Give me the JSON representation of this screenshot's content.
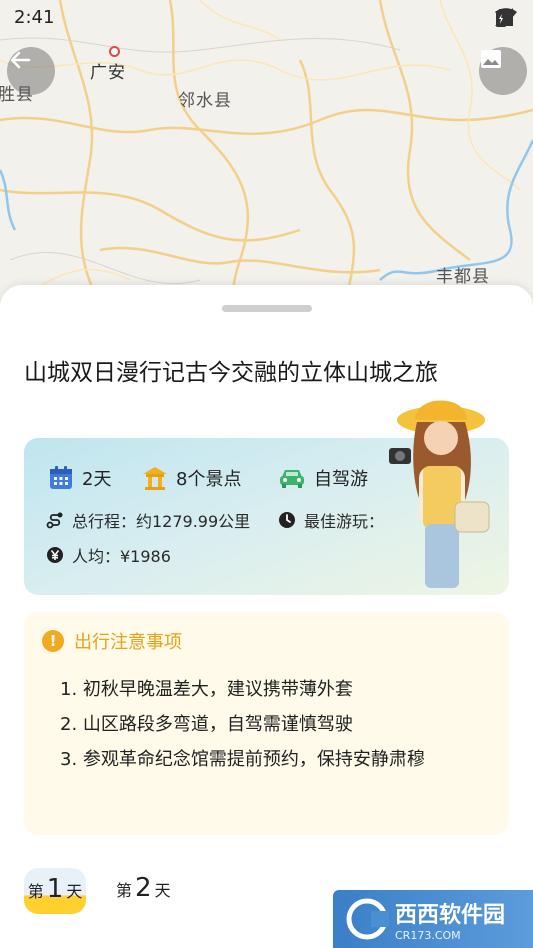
{
  "status": {
    "time": "2:41"
  },
  "map": {
    "labels": {
      "guangan": "广安",
      "linshui": "邻水县",
      "fengdu": "丰都县",
      "edge_left": "胜县"
    }
  },
  "trip": {
    "title": "山城双日漫行记古今交融的立体山城之旅",
    "days": "2天",
    "spots": "8个景点",
    "mode": "自驾游",
    "distance": "总行程：约1279.99公里",
    "best_time": "最佳游玩：",
    "cost": "人均：¥1986"
  },
  "notice": {
    "heading": "出行注意事项",
    "items": [
      "1. 初秋早晚温差大，建议携带薄外套",
      "2. 山区路段多弯道，自驾需谨慎驾驶",
      "3. 参观革命纪念馆需提前预约，保持安静肃穆"
    ]
  },
  "day_tabs": [
    {
      "prefix": "第",
      "num": "1",
      "suffix": "天"
    },
    {
      "prefix": "第",
      "num": "2",
      "suffix": "天"
    }
  ],
  "watermark": {
    "main": "西西软件园",
    "sub": "CR173.COM"
  },
  "colors": {
    "accent_yellow": "#ffd12f",
    "notice_orange": "#e7a21a",
    "calendar_blue": "#3d7be0",
    "car_green": "#3bb36a"
  }
}
